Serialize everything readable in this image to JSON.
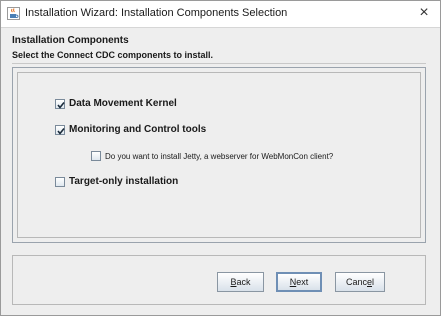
{
  "window": {
    "title": "Installation Wizard: Installation Components Selection",
    "close_glyph": "×",
    "app_icon": "java-cup-icon"
  },
  "header": {
    "title": "Installation Components",
    "subtitle": "Select the Connect CDC components to install."
  },
  "options": [
    {
      "label": "Data Movement Kernel",
      "checked": true
    },
    {
      "label": "Monitoring and Control tools",
      "checked": true
    },
    {
      "label": "Do you want to install Jetty, a webserver for WebMonCon client?",
      "checked": false
    },
    {
      "label": "Target-only installation",
      "checked": false
    }
  ],
  "buttons": {
    "back": {
      "mnemonic": "B",
      "rest": "ack"
    },
    "next": {
      "mnemonic": "N",
      "rest": "ext"
    },
    "cancel": {
      "pre": "Canc",
      "mnemonic": "e",
      "rest": "l"
    }
  },
  "colors": {
    "titlebar": "#ffffff",
    "window_bg": "#eeeeee",
    "focus_border": "#6f8fb5"
  }
}
